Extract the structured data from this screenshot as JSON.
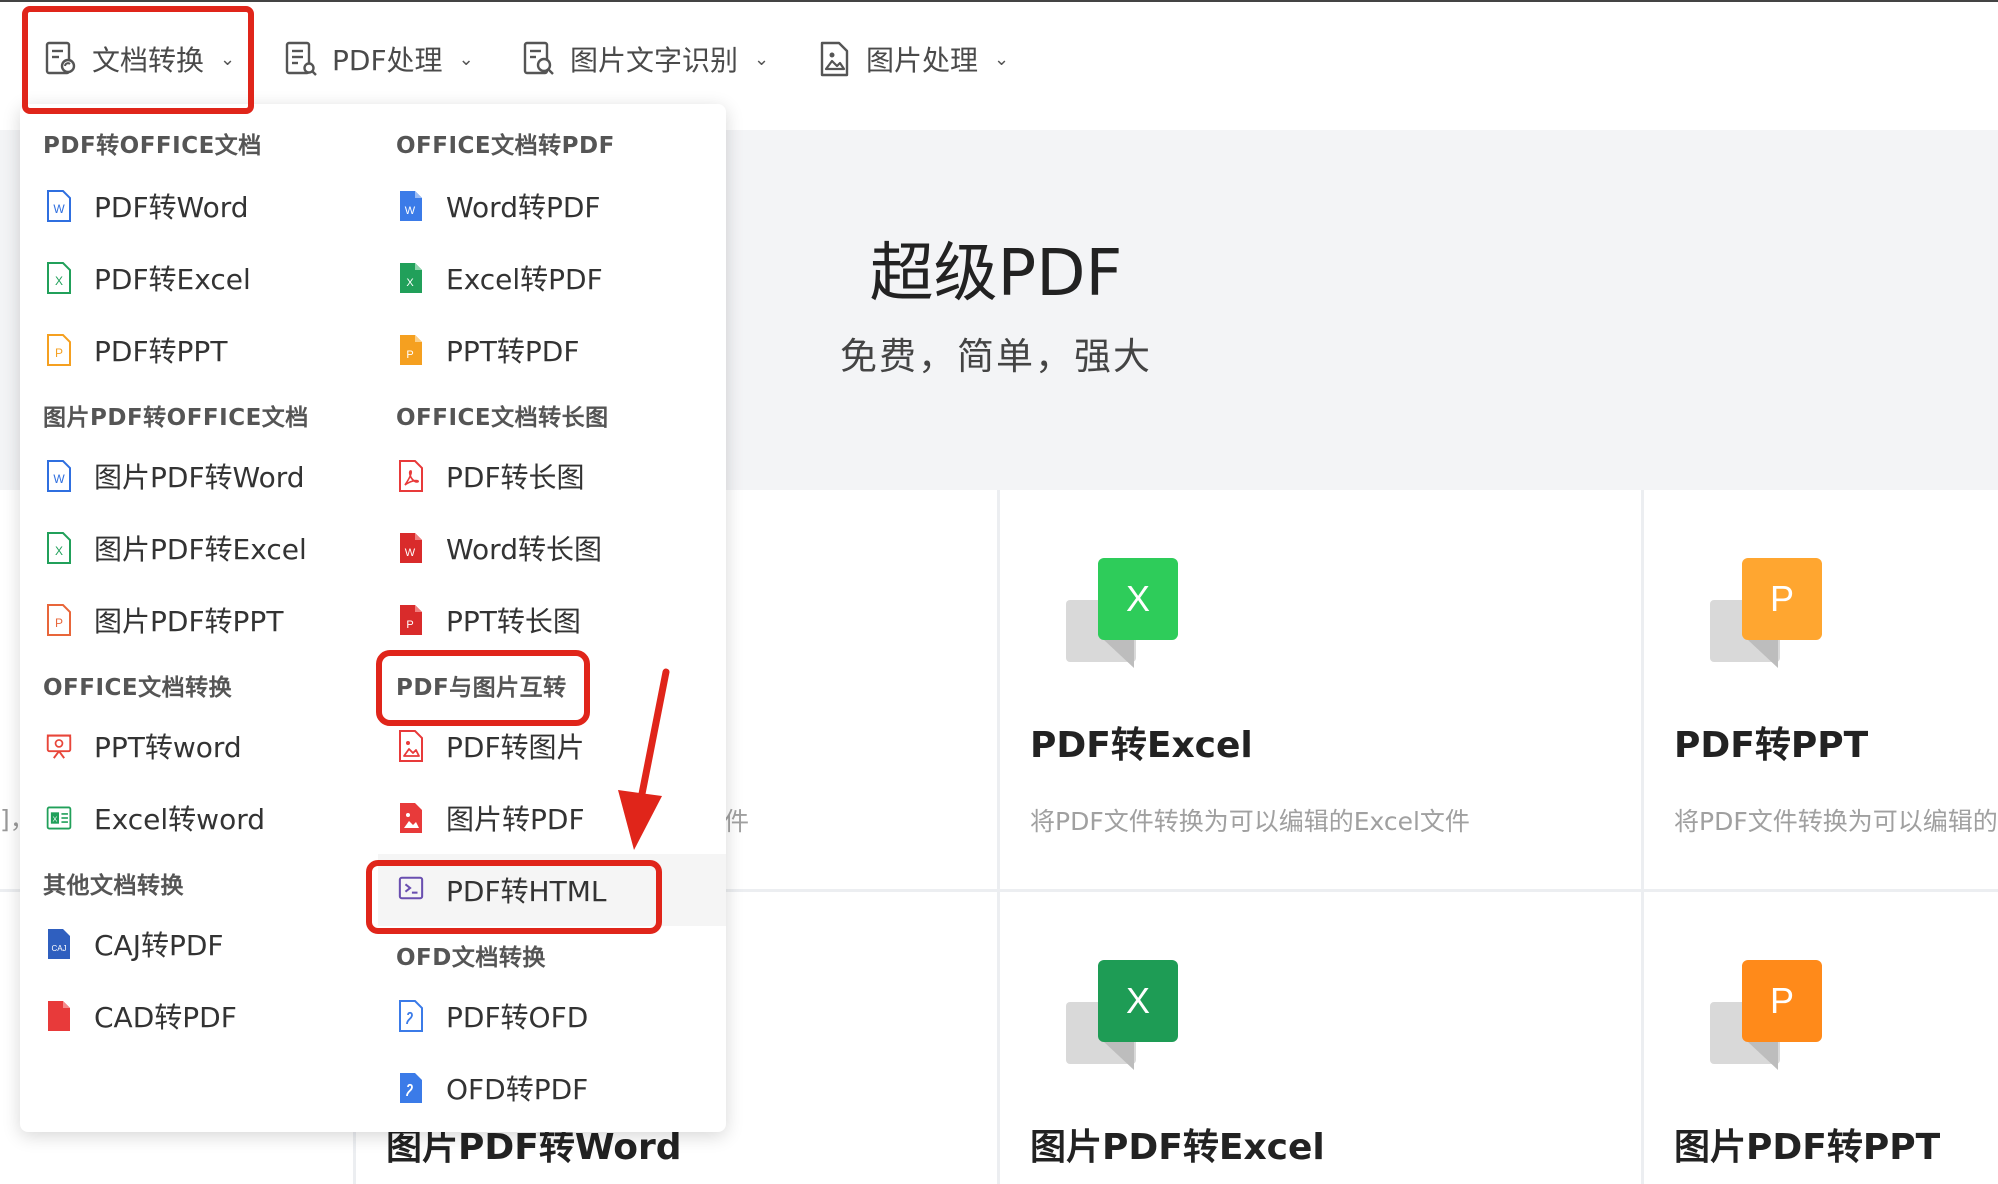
{
  "nav": {
    "items": [
      {
        "label": "文档转换",
        "icon": "doc-convert-icon"
      },
      {
        "label": "PDF处理",
        "icon": "pdf-process-icon"
      },
      {
        "label": "图片文字识别",
        "icon": "ocr-icon"
      },
      {
        "label": "图片处理",
        "icon": "image-process-icon"
      }
    ]
  },
  "hero": {
    "title": "超级PDF",
    "subtitle": "免费，简单，强大"
  },
  "dropdown": {
    "left": [
      {
        "heading": "PDF转OFFICE文档",
        "items": [
          {
            "label": "PDF转Word",
            "icon": "word-outline-icon",
            "color": "#2f6fe0"
          },
          {
            "label": "PDF转Excel",
            "icon": "excel-outline-icon",
            "color": "#21a05a"
          },
          {
            "label": "PDF转PPT",
            "icon": "ppt-outline-icon",
            "color": "#f5a020"
          }
        ]
      },
      {
        "heading": "图片PDF转OFFICE文档",
        "items": [
          {
            "label": "图片PDF转Word",
            "icon": "word-outline-icon",
            "color": "#2f6fe0"
          },
          {
            "label": "图片PDF转Excel",
            "icon": "excel-outline-icon",
            "color": "#21a05a"
          },
          {
            "label": "图片PDF转PPT",
            "icon": "ppt-outline-icon",
            "color": "#e8663a"
          }
        ]
      },
      {
        "heading": "OFFICE文档转换",
        "items": [
          {
            "label": "PPT转word",
            "icon": "presentation-icon",
            "color": "#e8463a"
          },
          {
            "label": "Excel转word",
            "icon": "sheet-icon",
            "color": "#21a05a"
          }
        ]
      },
      {
        "heading": "其他文档转换",
        "items": [
          {
            "label": "CAJ转PDF",
            "icon": "caj-icon",
            "color": "#2f5fbf"
          },
          {
            "label": "CAD转PDF",
            "icon": "cad-icon",
            "color": "#e83a3a"
          }
        ]
      }
    ],
    "right": [
      {
        "heading": "OFFICE文档转PDF",
        "items": [
          {
            "label": "Word转PDF",
            "icon": "word-solid-icon",
            "color": "#3b7be8"
          },
          {
            "label": "Excel转PDF",
            "icon": "excel-solid-icon",
            "color": "#21a05a"
          },
          {
            "label": "PPT转PDF",
            "icon": "ppt-solid-icon",
            "color": "#f5a020"
          }
        ]
      },
      {
        "heading": "OFFICE文档转长图",
        "items": [
          {
            "label": "PDF转长图",
            "icon": "pdf-outline-icon",
            "color": "#e83a3a"
          },
          {
            "label": "Word转长图",
            "icon": "word-red-icon",
            "color": "#d92b2b"
          },
          {
            "label": "PPT转长图",
            "icon": "ppt-red-icon",
            "color": "#d92b2b"
          }
        ]
      },
      {
        "heading": "PDF与图片互转",
        "items": [
          {
            "label": "PDF转图片",
            "icon": "image-outline-icon",
            "color": "#e83a3a"
          },
          {
            "label": "图片转PDF",
            "icon": "image-solid-icon",
            "color": "#e83a3a"
          },
          {
            "label": "PDF转HTML",
            "icon": "terminal-icon",
            "color": "#6a4fb0"
          }
        ]
      },
      {
        "heading": "OFD文档转换",
        "items": [
          {
            "label": "PDF转OFD",
            "icon": "ofd-outline-icon",
            "color": "#3b7be8"
          },
          {
            "label": "OFD转PDF",
            "icon": "ofd-solid-icon",
            "color": "#3b7be8"
          }
        ]
      }
    ]
  },
  "cards": [
    {
      "title": "PDF转Excel",
      "desc": "将PDF文件转换为可以编辑的Excel文件",
      "badge": "X",
      "color": "#2ecc5a",
      "icon": "excel-card-icon"
    },
    {
      "title": "PDF转PPT",
      "desc": "将PDF文件转换为可以编辑的",
      "badge": "P",
      "color": "#ffa630",
      "icon": "ppt-card-icon"
    },
    {
      "title": "图片PDF转Word",
      "desc": "",
      "badge": "",
      "color": "",
      "icon": ""
    },
    {
      "title": "图片PDF转Excel",
      "desc": "",
      "badge": "X",
      "color": "#1e9c55",
      "icon": "excel-card-icon-dark"
    },
    {
      "title": "图片PDF转PPT",
      "desc": "",
      "badge": "P",
      "color": "#ff8a1a",
      "icon": "ppt-card-icon-dark"
    }
  ],
  "partial": {
    "card_desc_tail": "件",
    "left_edge_glyph": "]，"
  },
  "annotation_color": "#e0251a"
}
